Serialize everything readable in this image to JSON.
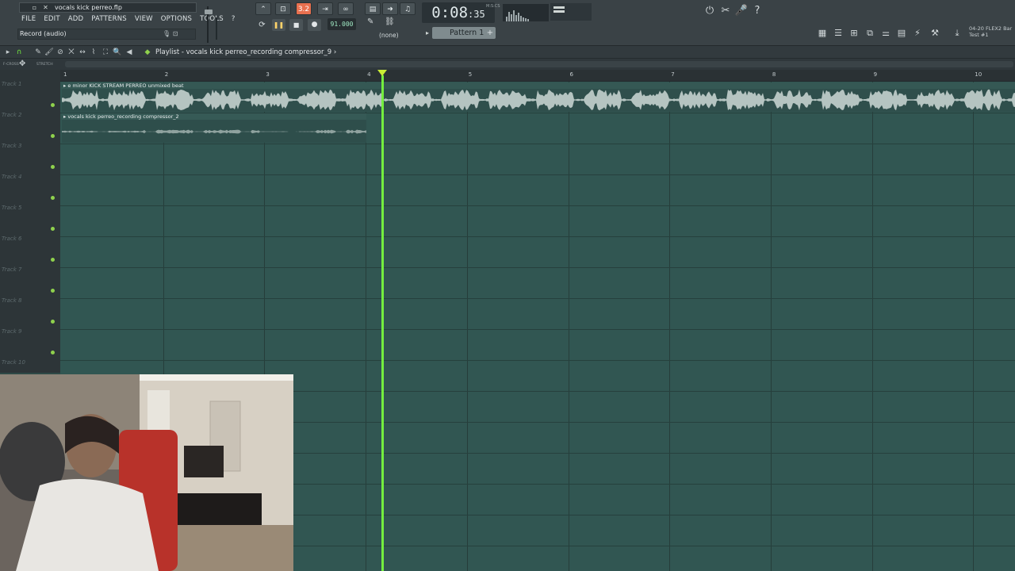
{
  "window": {
    "file_title": "vocals kick perreo.flp"
  },
  "menu": {
    "items": [
      "FILE",
      "EDIT",
      "ADD",
      "PATTERNS",
      "VIEW",
      "OPTIONS",
      "TOOLS",
      "?"
    ]
  },
  "hint_bar": {
    "text": "Record (audio)"
  },
  "transport": {
    "tempo": "91.000",
    "time_main": "0:08",
    "time_frac": "35",
    "time_unit": "M:S:CS",
    "pattern_none": "(none)",
    "pattern_name": "Pattern 1",
    "tempo_mode": "3.2"
  },
  "news": {
    "line1": "04-20  FLEX2 Bar",
    "line2": "Test #1"
  },
  "playlist": {
    "title": "Playlist - vocals kick perreo_recording compressor_9",
    "sub_labels": [
      "F-CROSS",
      "STRETCH"
    ],
    "tracks": [
      "Track 1",
      "Track 2",
      "Track 3",
      "Track 4",
      "Track 5",
      "Track 6",
      "Track 7",
      "Track 8",
      "Track 9",
      "Track 10"
    ],
    "bars": [
      "1",
      "2",
      "3",
      "4",
      "5",
      "6",
      "7",
      "8",
      "9",
      "10"
    ],
    "clips": [
      {
        "name": "e minor KICK STREAM PERREO unmixed beat",
        "track": 1
      },
      {
        "name": "vocals kick perreo_recording compressor_2",
        "track": 2
      }
    ],
    "playhead_bar": 4.15
  },
  "colors": {
    "accent": "#e8704f",
    "playhead": "#74ee3f",
    "grid_bg": "#315652",
    "led": "#8fd14d"
  }
}
